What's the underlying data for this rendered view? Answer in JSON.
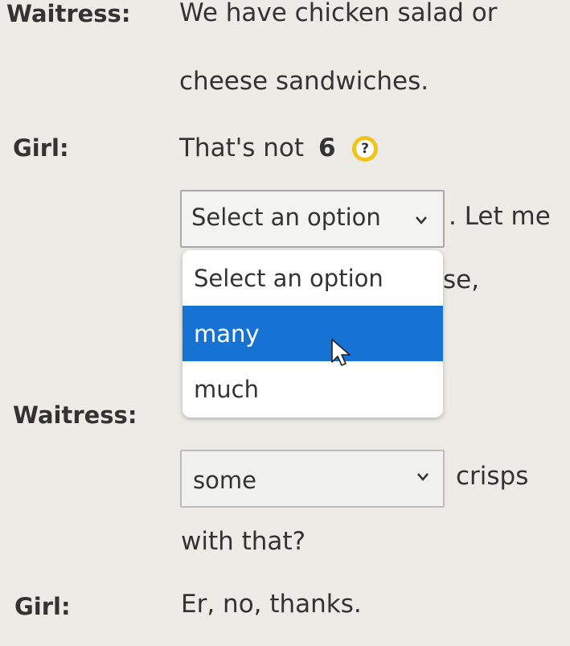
{
  "dialogue": {
    "waitress_label_1": "Waitress:",
    "waitress_line_1a": "We have chicken salad or",
    "waitress_line_1b": "cheese sandwiches.",
    "girl_label_1": "Girl:",
    "girl_line_1_text": "That's not",
    "girl_line_1_number": "6",
    "girl_line_1_after_select": ". Let me",
    "girl_line_1_partial": "se,",
    "waitress_label_2": "Waitress:",
    "waitress_line_2_after_select": "crisps",
    "waitress_line_2b": "with that?",
    "girl_label_2": "Girl:",
    "girl_line_2": "Er, no, thanks."
  },
  "help_button": {
    "icon": "question-icon",
    "symbol": "?",
    "color": "#f0c41c"
  },
  "select_1": {
    "value": "Select an option",
    "options": [
      "Select an option",
      "many",
      "much"
    ],
    "highlighted": "many"
  },
  "select_2": {
    "value": "some"
  },
  "colors": {
    "highlight": "#1673d4",
    "background": "#ecebe6",
    "text": "#333333"
  }
}
